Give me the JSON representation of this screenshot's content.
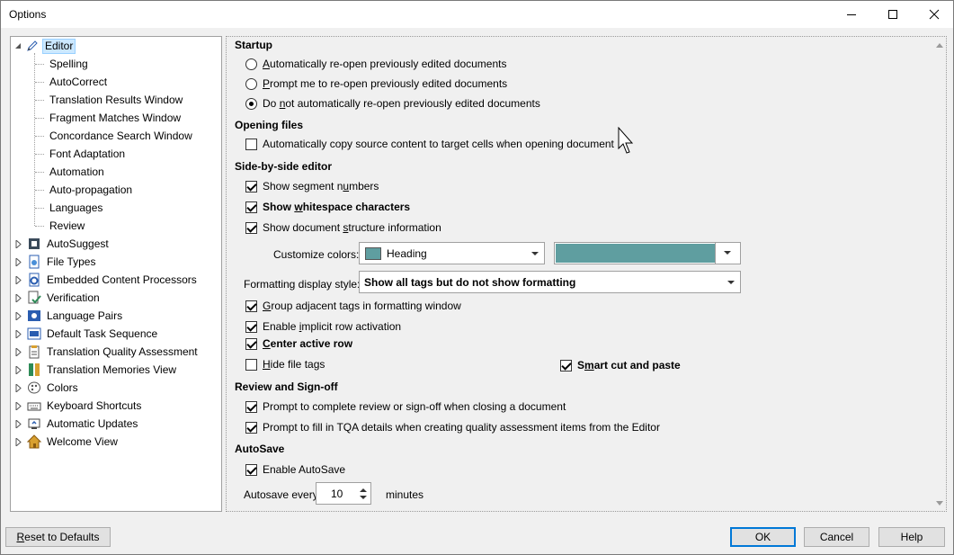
{
  "window": {
    "title": "Options"
  },
  "tree": {
    "items": [
      {
        "label": "Editor",
        "icon": "pencil-icon",
        "selected": true
      },
      {
        "label": "Spelling"
      },
      {
        "label": "AutoCorrect"
      },
      {
        "label": "Translation Results Window"
      },
      {
        "label": "Fragment Matches Window"
      },
      {
        "label": "Concordance Search Window"
      },
      {
        "label": "Font Adaptation"
      },
      {
        "label": "Automation"
      },
      {
        "label": "Auto-propagation"
      },
      {
        "label": "Languages"
      },
      {
        "label": "Review"
      },
      {
        "label": "AutoSuggest",
        "icon": "autosuggest-icon"
      },
      {
        "label": "File Types",
        "icon": "file-types-icon"
      },
      {
        "label": "Embedded Content Processors",
        "icon": "gear-document-icon"
      },
      {
        "label": "Verification",
        "icon": "verification-icon"
      },
      {
        "label": "Language Pairs",
        "icon": "language-pairs-icon"
      },
      {
        "label": "Default Task Sequence",
        "icon": "task-sequence-icon"
      },
      {
        "label": "Translation Quality Assessment",
        "icon": "clipboard-icon"
      },
      {
        "label": "Translation Memories View",
        "icon": "translation-memories-icon"
      },
      {
        "label": "Colors",
        "icon": "palette-icon"
      },
      {
        "label": "Keyboard Shortcuts",
        "icon": "keyboard-icon"
      },
      {
        "label": "Automatic Updates",
        "icon": "updates-icon"
      },
      {
        "label": "Welcome View",
        "icon": "home-icon"
      }
    ]
  },
  "startup": {
    "heading": "Startup",
    "options": [
      {
        "pre": "",
        "u": "A",
        "post": "utomatically re-open previously edited documents",
        "checked": false
      },
      {
        "pre": "",
        "u": "P",
        "post": "rompt me to re-open previously edited documents",
        "checked": false
      },
      {
        "pre": "Do ",
        "u": "n",
        "post": "ot automatically re-open previously edited documents",
        "checked": true
      }
    ]
  },
  "opening_files": {
    "heading": "Opening files",
    "copy_source": {
      "label": "Automatically copy source content to target cells when opening document",
      "checked": false
    }
  },
  "side_by_side": {
    "heading": "Side-by-side editor",
    "show_segment_numbers": {
      "pre": "Show segment n",
      "u": "u",
      "post": "mbers",
      "checked": true
    },
    "show_whitespace": {
      "pre": "Show ",
      "u": "w",
      "post": "hitespace characters",
      "checked": true
    },
    "show_structure": {
      "pre": "Show document ",
      "u": "s",
      "post": "tructure information",
      "checked": true
    },
    "customize_colors_label": "Customize colors:",
    "color_item": "Heading",
    "color_swatch": "#5f9ea0",
    "formatting_style_label": "Formatting display style:",
    "formatting_style_value": "Show all tags but do not show formatting",
    "group_tags": {
      "pre": "",
      "u": "G",
      "post": "roup adjacent tags in formatting window",
      "checked": true
    },
    "implicit_row": {
      "pre": "Enable ",
      "u": "i",
      "post": "mplicit row activation",
      "checked": true
    },
    "center_row": {
      "pre": "",
      "u": "C",
      "post": "enter active row",
      "checked": true
    },
    "hide_file_tags": {
      "pre": "",
      "u": "H",
      "post": "ide file tags",
      "checked": false
    },
    "smart_cut": {
      "pre": "S",
      "u": "m",
      "post": "art cut and paste",
      "checked": true
    }
  },
  "review": {
    "heading": "Review and Sign-off",
    "prompt_complete": {
      "label": "Prompt to complete review or sign-off when closing a document",
      "checked": true
    },
    "prompt_tqa": {
      "label": "Prompt to fill in TQA details when creating quality assessment items from the Editor",
      "checked": true
    }
  },
  "autosave": {
    "heading": "AutoSave",
    "enable": {
      "label": "Enable AutoSave",
      "checked": true
    },
    "every_label": "Autosave every",
    "interval": "10",
    "unit": "minutes"
  },
  "buttons": {
    "reset": {
      "pre": "",
      "u": "R",
      "post": "eset to Defaults"
    },
    "ok": "OK",
    "cancel": "Cancel",
    "help": "Help"
  }
}
